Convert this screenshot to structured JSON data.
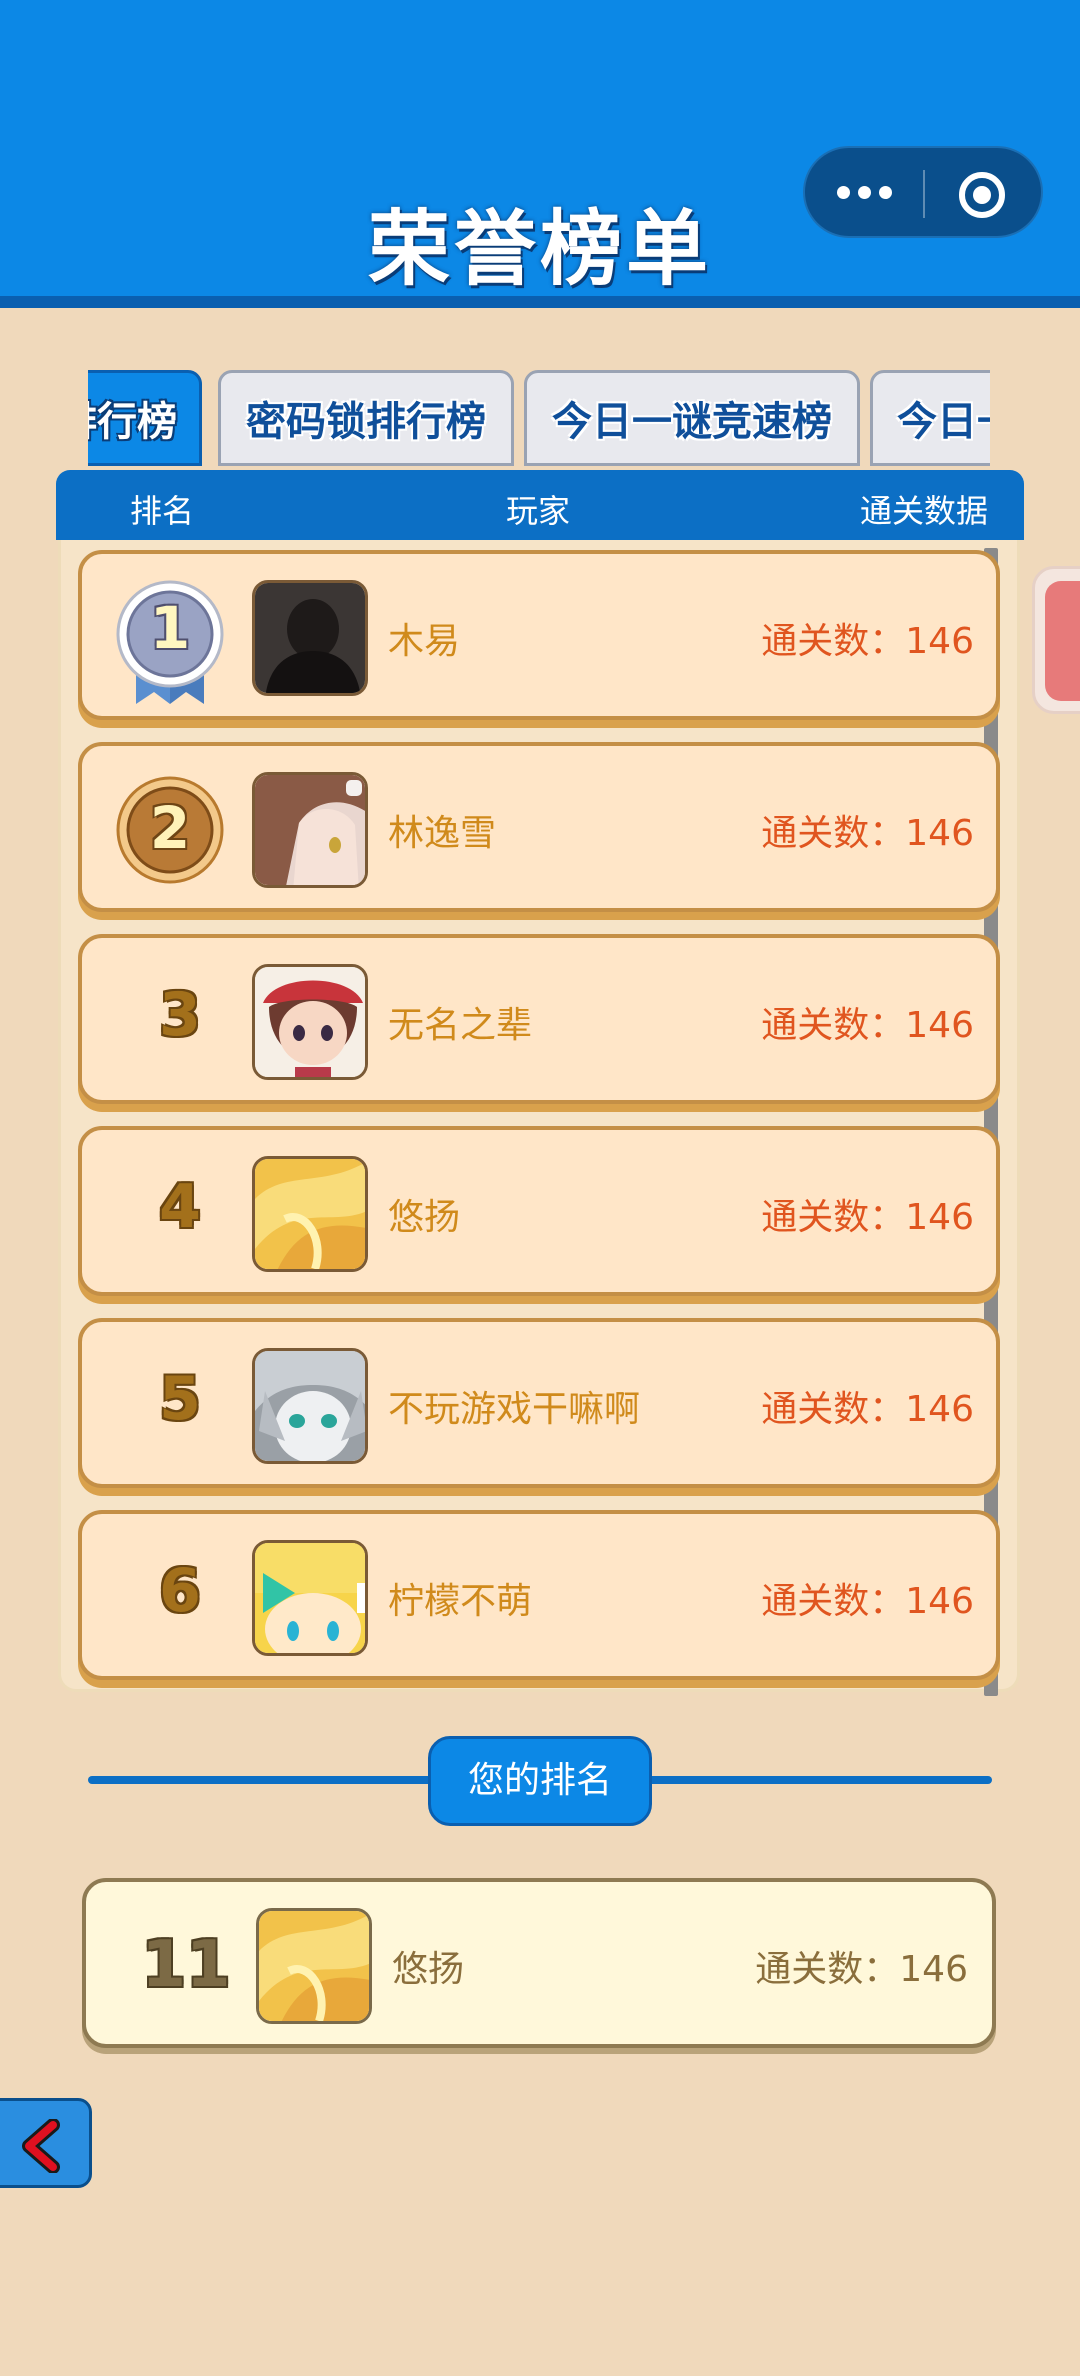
{
  "header": {
    "title": "荣誉榜单"
  },
  "tabs": [
    {
      "label": "排行榜",
      "visible_text": "排行榜",
      "active": true
    },
    {
      "label": "密码锁排行榜",
      "active": false
    },
    {
      "label": "今日一谜竞速榜",
      "active": false
    },
    {
      "label": "今日一",
      "visible_text": "今日一",
      "active": false
    }
  ],
  "table_header": {
    "rank": "排名",
    "player": "玩家",
    "data": "通关数据"
  },
  "rows": [
    {
      "rank": "1",
      "name": "木易",
      "score": "通关数：146",
      "avatar": "dark-silhouette-avatar",
      "medal": "silver-ribbon-medal"
    },
    {
      "rank": "2",
      "name": "林逸雪",
      "score": "通关数：146",
      "avatar": "anime-girl-avatar",
      "medal": "bronze-medal"
    },
    {
      "rank": "3",
      "name": "无名之辈",
      "score": "通关数：146",
      "avatar": "cartoon-girl-avatar"
    },
    {
      "rank": "4",
      "name": "悠扬",
      "score": "通关数：146",
      "avatar": "yellow-flower-avatar"
    },
    {
      "rank": "5",
      "name": "不玩游戏干嘛啊",
      "score": "通关数：146",
      "avatar": "silver-hair-boy-avatar"
    },
    {
      "rank": "6",
      "name": "柠檬不萌",
      "score": "通关数：146",
      "avatar": "blonde-chibi-avatar"
    }
  ],
  "my_rank_label": "您的排名",
  "my_rank": {
    "rank": "11",
    "name": "悠扬",
    "score": "通关数：146",
    "avatar": "yellow-flower-avatar"
  },
  "icons": {
    "menu": "more-dots-icon",
    "close": "target-circle-icon",
    "back": "chevron-left-icon"
  },
  "colors": {
    "header_blue": "#0c88e6",
    "background": "#f0d9bb",
    "row_bg": "#ffe6c8",
    "name_color": "#d08a1b",
    "score_color": "#e0551f",
    "back_arrow": "#e01020"
  }
}
